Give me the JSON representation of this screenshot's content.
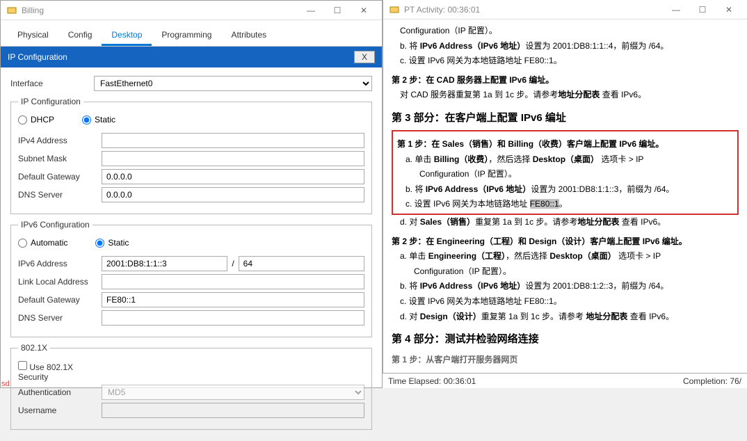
{
  "leftWindow": {
    "title": "Billing",
    "tabs": [
      "Physical",
      "Config",
      "Desktop",
      "Programming",
      "Attributes"
    ],
    "activeTab": 2,
    "panelTitle": "IP Configuration",
    "panelClose": "X",
    "interfaceLabel": "Interface",
    "interfaceValue": "FastEthernet0",
    "ipcfg": {
      "legend": "IP Configuration",
      "dhcp": "DHCP",
      "static": "Static",
      "ipv4_label": "IPv4 Address",
      "ipv4_value": "",
      "subnet_label": "Subnet Mask",
      "subnet_value": "",
      "gateway_label": "Default Gateway",
      "gateway_value": "0.0.0.0",
      "dns_label": "DNS Server",
      "dns_value": "0.0.0.0"
    },
    "ipv6cfg": {
      "legend": "IPv6 Configuration",
      "auto": "Automatic",
      "static": "Static",
      "addr_label": "IPv6 Address",
      "addr_value": "2001:DB8:1:1::3",
      "addr_prefix": "64",
      "ll_label": "Link Local Address",
      "ll_value": "",
      "gw_label": "Default Gateway",
      "gw_value": "FE80::1",
      "dns_label": "DNS Server",
      "dns_value": ""
    },
    "dot1x": {
      "legend": "802.1X",
      "use": "Use 802.1X Security",
      "auth_label": "Authentication",
      "auth_value": "MD5",
      "user_label": "Username",
      "user_value": ""
    }
  },
  "rightWindow": {
    "title": "PT Activity: 00:36:01",
    "lines": {
      "l1_pre": "Configuration（IP 配置）",
      "l1_post": "。",
      "l2_b_pre": "b.  将 ",
      "l2_bold": "IPv6 Address（IPv6 地址）",
      "l2_b_post": "设置为 2001:DB8:1:1::4，前缀为 /64。",
      "l3_c_pre": "c.  设置 IPv6 网关为本地链路地址 FE80::1。",
      "step2_title": "第 2 步：在 CAD 服务器上配置 IPv6 编址。",
      "step2_body_pre": "对 CAD 服务器重复第 1a 到 1c 步。请参考",
      "step2_body_bold": "地址分配表",
      "step2_body_post": " 查看 IPv6。",
      "sec3_title": "第 3 部分：在客户端上配置 IPv6 编址",
      "red_step1": "第 1 步：在 Sales（销售）和 Billing（收费）客户端上配置 IPv6 编址。",
      "red_a_pre": "a.  单击 ",
      "red_a_b1": "Billing（收费）",
      "red_a_mid": "，然后选择 ",
      "red_a_b2": "Desktop（桌面）",
      "red_a_post": " 选项卡 > IP",
      "red_a_line2": "      Configuration（IP 配置）。",
      "red_b_pre": "b.  将 ",
      "red_b_b1": "IPv6 Address（IPv6 地址）",
      "red_b_post": "设置为 2001:DB8:1:1::3，前缀为 /64。",
      "red_c_pre": "c.  设置 IPv6 网关为本地链路地址 ",
      "red_c_hl": "FE80::1",
      "red_c_post": "。",
      "d_pre": "d.  对 ",
      "d_b1": "Sales（销售）",
      "d_mid": "重复第 1a 到 1c 步。请参考",
      "d_b2": "地址分配表",
      "d_post": " 查看 IPv6。",
      "step22_title": "第 2 步：在 Engineering（工程）和 Design（设计）客户端上配置 IPv6 编址。",
      "s22_a_pre": "a.  单击 ",
      "s22_a_b1": "Engineering（工程）",
      "s22_a_mid": "，然后选择 ",
      "s22_a_b2": "Desktop（桌面）",
      "s22_a_post": " 选项卡 > IP",
      "s22_a_line2": "      Configuration（IP 配置）。",
      "s22_b_pre": "b.  将 ",
      "s22_b_b1": "IPv6 Address（IPv6 地址）",
      "s22_b_post": "设置为 2001:DB8:1:2::3，前缀为 /64。",
      "s22_c": "c.  设置 IPv6 网关为本地链路地址 FE80::1。",
      "s22_d_pre": "d.  对 ",
      "s22_d_b1": "Design（设计）",
      "s22_d_mid": "重复第 1a 到 1c 步。请参考 ",
      "s22_d_b2": "地址分配表",
      "s22_d_post": " 查看 IPv6。",
      "sec4_title": "第 4 部分：测试并检验网络连接",
      "cut": "第 1 步：从客户端打开服务器网页"
    },
    "status_left": "Time Elapsed: 00:36:01",
    "status_right": "Completion: 76/"
  },
  "sd": "sd"
}
